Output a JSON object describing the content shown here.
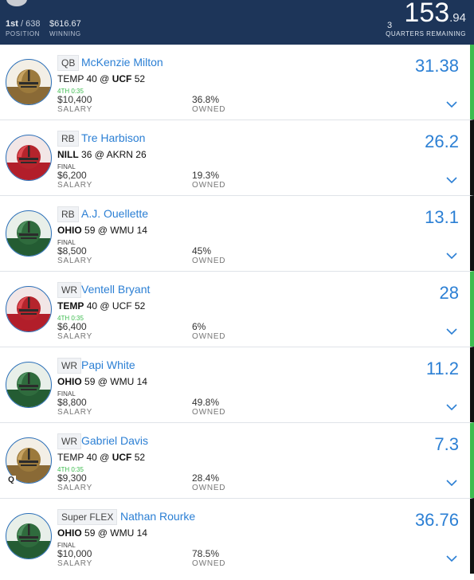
{
  "header": {
    "position_value": "1st",
    "position_total": "/ 638",
    "position_label": "POSITION",
    "winning_value": "$616.67",
    "winning_label": "WINNING",
    "quarters_count": "3",
    "quarters_label": "QUARTERS REMAINING",
    "score_int": "153",
    "score_dec": ".94"
  },
  "colors": {
    "header_bg": "#1d3559",
    "accent": "#2b7fd4",
    "live_bar": "#3dbc4f",
    "final_bar": "#111111"
  },
  "players": [
    {
      "pos": "QB",
      "name": "McKenzie Milton",
      "team1": "TEMP",
      "score1": "40",
      "at": "@",
      "team2": "UCF",
      "score2": "52",
      "bold_team": 2,
      "status": "4TH 0:35",
      "live": true,
      "salary": "$10,400",
      "salary_label": "SALARY",
      "owned": "36.8%",
      "owned_label": "OWNED",
      "points": "31.38",
      "helmet": "gold",
      "badge": ""
    },
    {
      "pos": "RB",
      "name": "Tre Harbison",
      "team1": "NILL",
      "score1": "36",
      "at": "@",
      "team2": "AKRN",
      "score2": "26",
      "bold_team": 1,
      "status": "FINAL",
      "live": false,
      "salary": "$6,200",
      "salary_label": "SALARY",
      "owned": "19.3%",
      "owned_label": "OWNED",
      "points": "26.2",
      "helmet": "red",
      "badge": ""
    },
    {
      "pos": "RB",
      "name": "A.J. Ouellette",
      "team1": "OHIO",
      "score1": "59",
      "at": "@",
      "team2": "WMU",
      "score2": "14",
      "bold_team": 1,
      "status": "FINAL",
      "live": false,
      "salary": "$8,500",
      "salary_label": "SALARY",
      "owned": "45%",
      "owned_label": "OWNED",
      "points": "13.1",
      "helmet": "green",
      "badge": ""
    },
    {
      "pos": "WR",
      "name": "Ventell Bryant",
      "team1": "TEMP",
      "score1": "40",
      "at": "@",
      "team2": "UCF",
      "score2": "52",
      "bold_team": 1,
      "status": "4TH 0:35",
      "live": true,
      "salary": "$6,400",
      "salary_label": "SALARY",
      "owned": "6%",
      "owned_label": "OWNED",
      "points": "28",
      "helmet": "red",
      "badge": ""
    },
    {
      "pos": "WR",
      "name": "Papi White",
      "team1": "OHIO",
      "score1": "59",
      "at": "@",
      "team2": "WMU",
      "score2": "14",
      "bold_team": 1,
      "status": "FINAL",
      "live": false,
      "salary": "$8,800",
      "salary_label": "SALARY",
      "owned": "49.8%",
      "owned_label": "OWNED",
      "points": "11.2",
      "helmet": "green",
      "badge": ""
    },
    {
      "pos": "WR",
      "name": "Gabriel Davis",
      "team1": "TEMP",
      "score1": "40",
      "at": "@",
      "team2": "UCF",
      "score2": "52",
      "bold_team": 2,
      "status": "4TH 0:35",
      "live": true,
      "salary": "$9,300",
      "salary_label": "SALARY",
      "owned": "28.4%",
      "owned_label": "OWNED",
      "points": "7.3",
      "helmet": "gold",
      "badge": "Q"
    },
    {
      "pos": "Super FLEX",
      "name": "Nathan Rourke",
      "team1": "OHIO",
      "score1": "59",
      "at": "@",
      "team2": "WMU",
      "score2": "14",
      "bold_team": 1,
      "status": "FINAL",
      "live": false,
      "salary": "$10,000",
      "salary_label": "SALARY",
      "owned": "78.5%",
      "owned_label": "OWNED",
      "points": "36.76",
      "helmet": "green",
      "badge": ""
    }
  ]
}
